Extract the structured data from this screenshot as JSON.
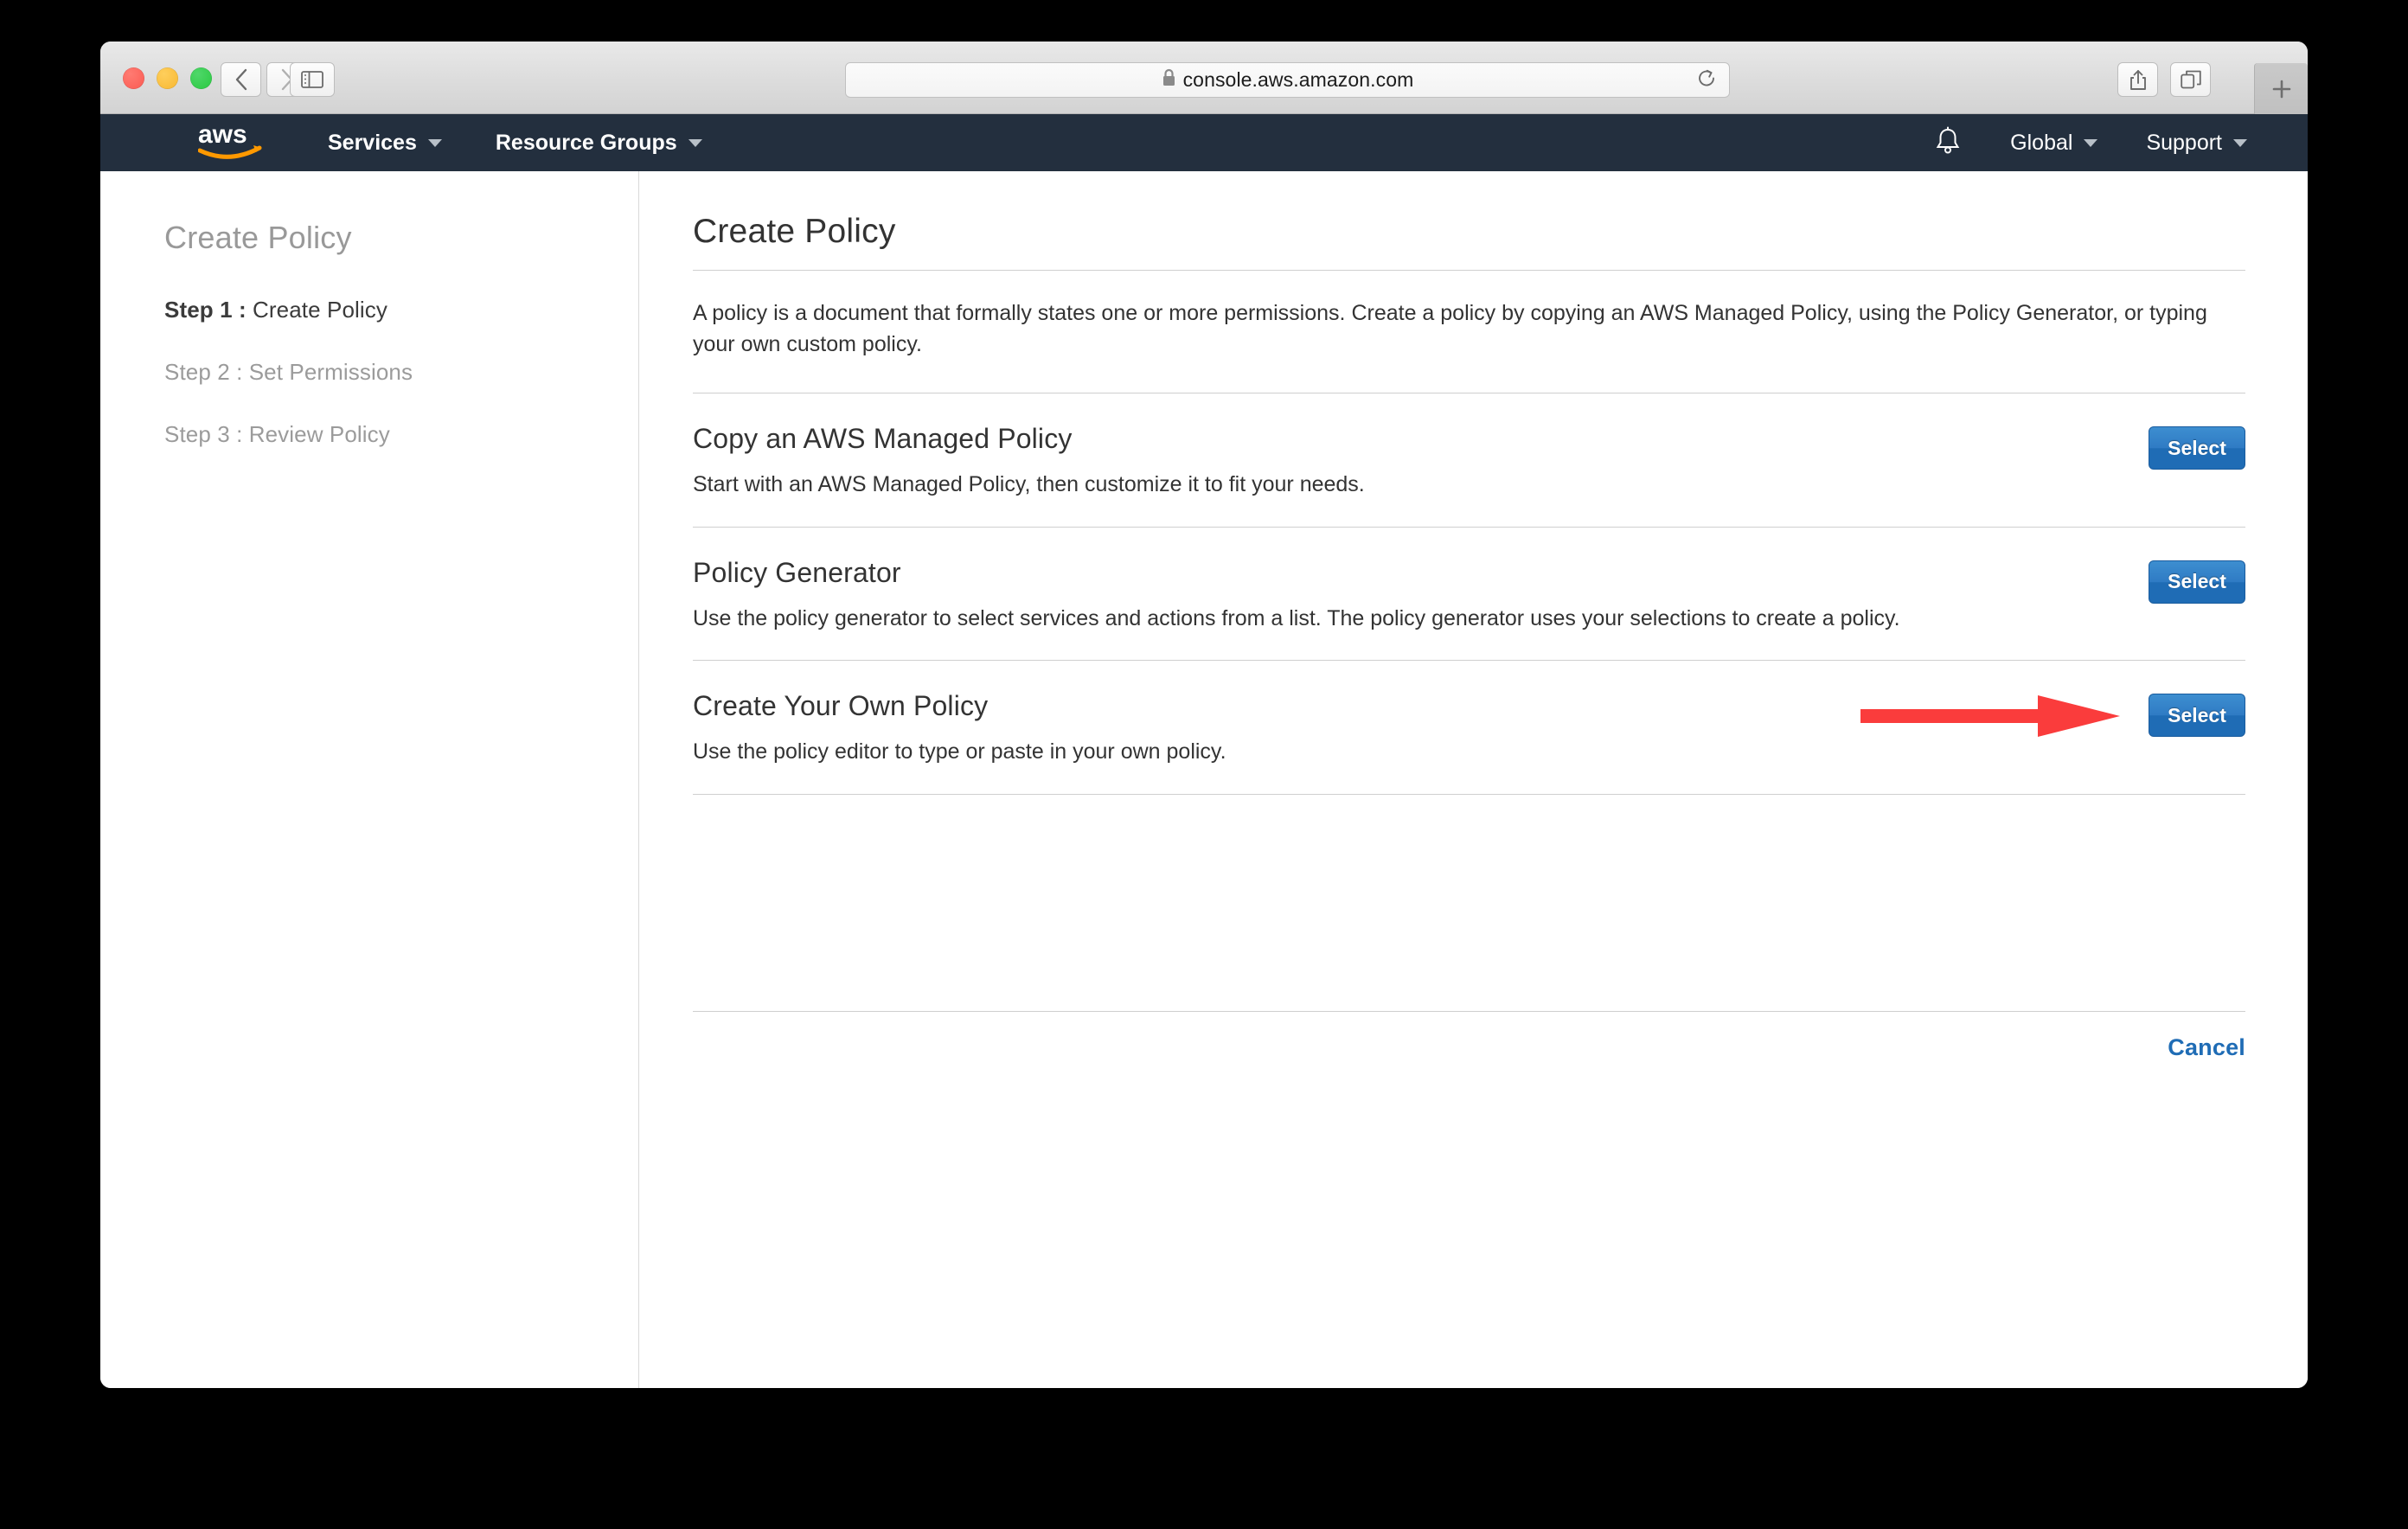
{
  "browser": {
    "url": "console.aws.amazon.com",
    "lock_icon": "lock-icon",
    "back_icon": "chevron-left-icon",
    "forward_icon": "chevron-right-icon",
    "sidebar_icon": "sidebar-toggle-icon",
    "reload_icon": "reload-icon",
    "share_icon": "share-icon",
    "tabs_icon": "tab-overview-icon",
    "new_tab_label": "+"
  },
  "aws_nav": {
    "logo": "aws",
    "services_label": "Services",
    "resource_groups_label": "Resource Groups",
    "bell_icon": "notification-bell-icon",
    "region_label": "Global",
    "support_label": "Support"
  },
  "sidebar": {
    "title": "Create Policy",
    "steps": [
      {
        "num": "Step 1 :",
        "label": " Create Policy",
        "active": true
      },
      {
        "num": "Step 2 :",
        "label": " Set Permissions",
        "active": false
      },
      {
        "num": "Step 3 :",
        "label": " Review Policy",
        "active": false
      }
    ]
  },
  "main": {
    "title": "Create Policy",
    "description": "A policy is a document that formally states one or more permissions. Create a policy by copying an AWS Managed Policy, using the Policy Generator, or typing your own custom policy.",
    "options": [
      {
        "title": "Copy an AWS Managed Policy",
        "description": "Start with an AWS Managed Policy, then customize it to fit your needs.",
        "button_label": "Select"
      },
      {
        "title": "Policy Generator",
        "description": "Use the policy generator to select services and actions from a list. The policy generator uses your selections to create a policy.",
        "button_label": "Select"
      },
      {
        "title": "Create Your Own Policy",
        "description": "Use the policy editor to type or paste in your own policy.",
        "button_label": "Select"
      }
    ],
    "cancel_label": "Cancel"
  },
  "annotation": {
    "arrow_color": "#fa3c3c",
    "arrow_points_to": "Select button for Create Your Own Policy"
  },
  "colors": {
    "aws_nav_background": "#232f3e",
    "aws_logo_smile": "#ff9900",
    "button_blue": "#1f6cb5",
    "link_blue": "#1f6cb5",
    "annotation_red": "#fa3c3c"
  }
}
